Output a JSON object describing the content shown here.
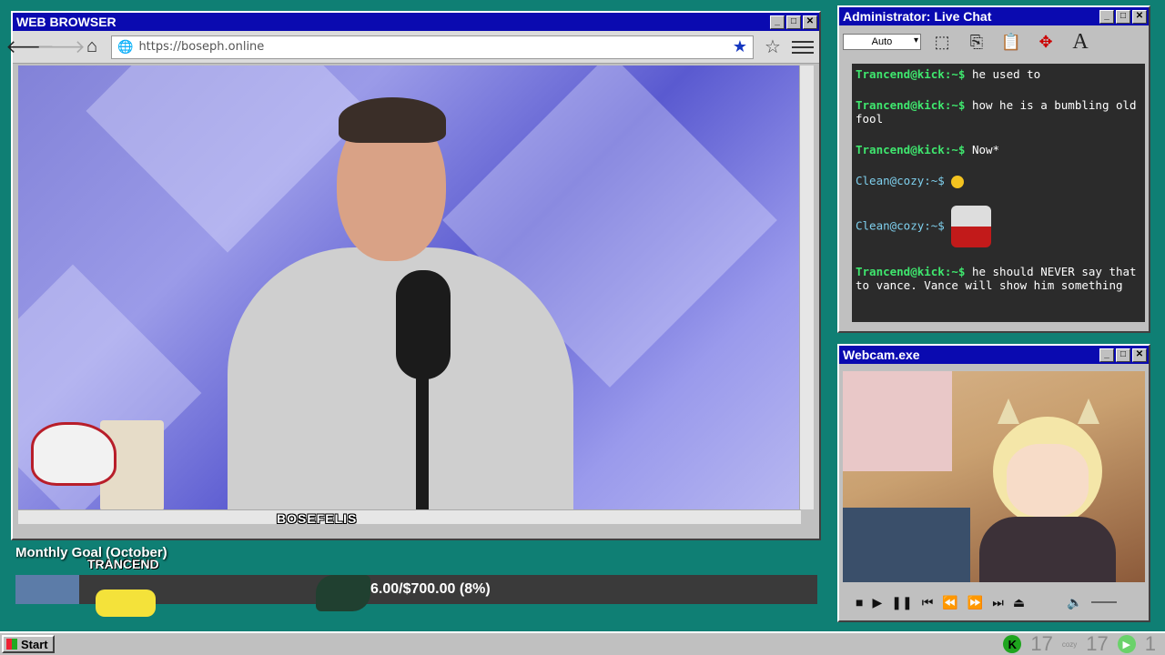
{
  "browser": {
    "title": "WEB BROWSER",
    "url": "https://boseph.online",
    "caption": "BOSEFELIS"
  },
  "chat": {
    "title": "Administrator: Live Chat",
    "zoom": "Auto",
    "messages": [
      {
        "user": "Trancend@kick:~$",
        "text": "he used to",
        "kind": "green"
      },
      {
        "user": "Trancend@kick:~$",
        "text": "how he is a bumbling old fool",
        "kind": "green"
      },
      {
        "user": "Trancend@kick:~$",
        "text": "Now*",
        "kind": "green"
      },
      {
        "user": "Clean@cozy:~$",
        "text": "",
        "kind": "cyan",
        "media": "emoji"
      },
      {
        "user": "Clean@cozy:~$",
        "text": "",
        "kind": "cyan",
        "media": "sticker"
      },
      {
        "user": "Trancend@kick:~$",
        "text": "he should NEVER say that to vance. Vance will show him something",
        "kind": "green"
      }
    ]
  },
  "webcam": {
    "title": "Webcam.exe"
  },
  "goal": {
    "title": "Monthly Goal (October)",
    "amount_text": "6.00/$700.00 (8%)",
    "progress_fraction": 0.08,
    "top_donor": "TRANCEND"
  },
  "taskbar": {
    "start_label": "Start",
    "kick_count": "17",
    "cozy_label": "cozy",
    "cozy_count": "17",
    "play_count": "1"
  }
}
